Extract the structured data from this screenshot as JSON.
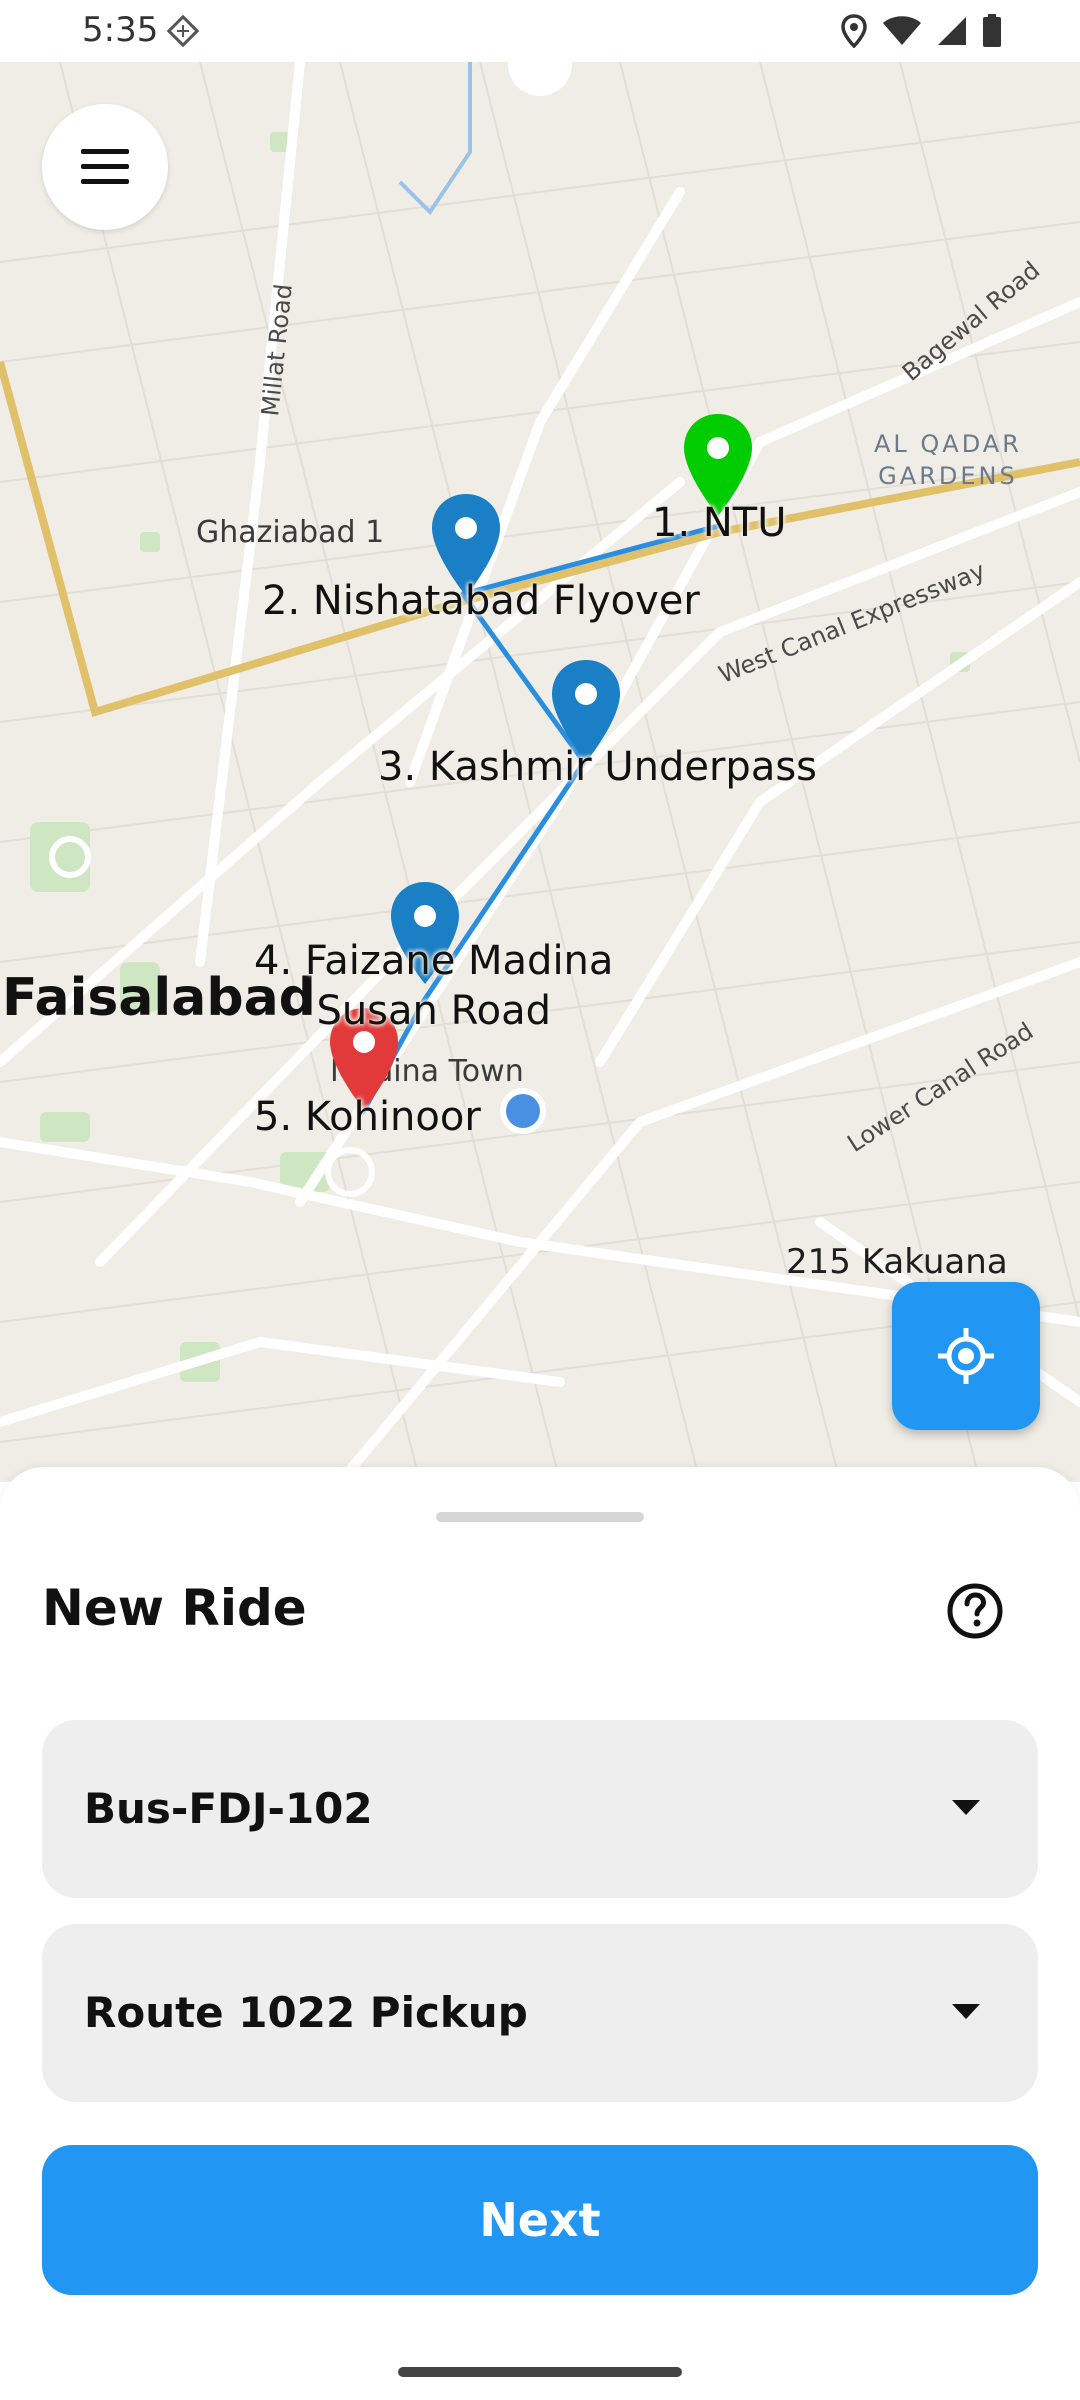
{
  "status_bar": {
    "time": "5:35",
    "left_icon": "diamond-assistant-icon",
    "right_icons": [
      "location-icon",
      "wifi-icon",
      "signal-icon",
      "battery-icon"
    ]
  },
  "map": {
    "city_label": "Faisalabad",
    "place_labels": [
      "Ghaziabad 1",
      "215 Kakuana",
      "AL QADAR\nGARDENS",
      "Madina Town"
    ],
    "road_labels": [
      "Millat Road",
      "Bagewal Road",
      "West Canal Expressway",
      "Lower Canal Road"
    ],
    "stops": [
      {
        "label": "1. NTU",
        "color": "#00cc00"
      },
      {
        "label": "2. Nishatabad Flyover",
        "color": "#1a7fc4"
      },
      {
        "label": "3. Kashmir Underpass",
        "color": "#1a7fc4"
      },
      {
        "label": "4. Faizane Madina\nSusan Road",
        "color": "#1a7fc4"
      },
      {
        "label": "5. Kohinoor",
        "color": "#e23a3a"
      }
    ],
    "route_color": "#2a8ee0",
    "menu_icon": "hamburger-menu-icon",
    "locate_icon": "gps-target-icon"
  },
  "sheet": {
    "title": "New Ride",
    "help_icon": "question-circle-icon",
    "vehicle_select": {
      "value": "Bus-FDJ-102"
    },
    "route_select": {
      "value": "Route 1022 Pickup"
    },
    "next_label": "Next"
  },
  "colors": {
    "accent": "#2196f3",
    "dropdown_bg": "#eeeeee"
  }
}
